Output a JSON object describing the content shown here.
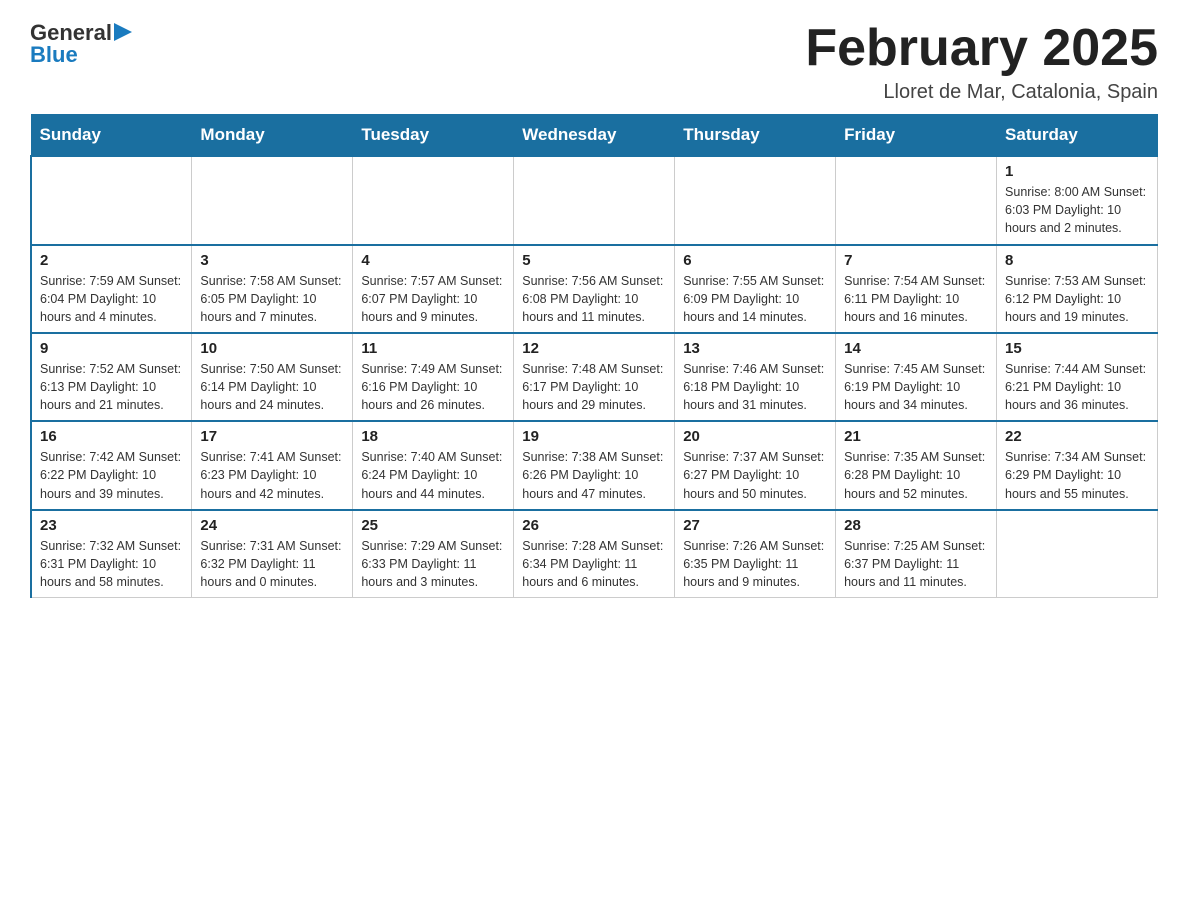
{
  "logo": {
    "general": "General",
    "blue": "Blue"
  },
  "title": "February 2025",
  "location": "Lloret de Mar, Catalonia, Spain",
  "weekdays": [
    "Sunday",
    "Monday",
    "Tuesday",
    "Wednesday",
    "Thursday",
    "Friday",
    "Saturday"
  ],
  "weeks": [
    [
      {
        "day": "",
        "info": ""
      },
      {
        "day": "",
        "info": ""
      },
      {
        "day": "",
        "info": ""
      },
      {
        "day": "",
        "info": ""
      },
      {
        "day": "",
        "info": ""
      },
      {
        "day": "",
        "info": ""
      },
      {
        "day": "1",
        "info": "Sunrise: 8:00 AM\nSunset: 6:03 PM\nDaylight: 10 hours and 2 minutes."
      }
    ],
    [
      {
        "day": "2",
        "info": "Sunrise: 7:59 AM\nSunset: 6:04 PM\nDaylight: 10 hours and 4 minutes."
      },
      {
        "day": "3",
        "info": "Sunrise: 7:58 AM\nSunset: 6:05 PM\nDaylight: 10 hours and 7 minutes."
      },
      {
        "day": "4",
        "info": "Sunrise: 7:57 AM\nSunset: 6:07 PM\nDaylight: 10 hours and 9 minutes."
      },
      {
        "day": "5",
        "info": "Sunrise: 7:56 AM\nSunset: 6:08 PM\nDaylight: 10 hours and 11 minutes."
      },
      {
        "day": "6",
        "info": "Sunrise: 7:55 AM\nSunset: 6:09 PM\nDaylight: 10 hours and 14 minutes."
      },
      {
        "day": "7",
        "info": "Sunrise: 7:54 AM\nSunset: 6:11 PM\nDaylight: 10 hours and 16 minutes."
      },
      {
        "day": "8",
        "info": "Sunrise: 7:53 AM\nSunset: 6:12 PM\nDaylight: 10 hours and 19 minutes."
      }
    ],
    [
      {
        "day": "9",
        "info": "Sunrise: 7:52 AM\nSunset: 6:13 PM\nDaylight: 10 hours and 21 minutes."
      },
      {
        "day": "10",
        "info": "Sunrise: 7:50 AM\nSunset: 6:14 PM\nDaylight: 10 hours and 24 minutes."
      },
      {
        "day": "11",
        "info": "Sunrise: 7:49 AM\nSunset: 6:16 PM\nDaylight: 10 hours and 26 minutes."
      },
      {
        "day": "12",
        "info": "Sunrise: 7:48 AM\nSunset: 6:17 PM\nDaylight: 10 hours and 29 minutes."
      },
      {
        "day": "13",
        "info": "Sunrise: 7:46 AM\nSunset: 6:18 PM\nDaylight: 10 hours and 31 minutes."
      },
      {
        "day": "14",
        "info": "Sunrise: 7:45 AM\nSunset: 6:19 PM\nDaylight: 10 hours and 34 minutes."
      },
      {
        "day": "15",
        "info": "Sunrise: 7:44 AM\nSunset: 6:21 PM\nDaylight: 10 hours and 36 minutes."
      }
    ],
    [
      {
        "day": "16",
        "info": "Sunrise: 7:42 AM\nSunset: 6:22 PM\nDaylight: 10 hours and 39 minutes."
      },
      {
        "day": "17",
        "info": "Sunrise: 7:41 AM\nSunset: 6:23 PM\nDaylight: 10 hours and 42 minutes."
      },
      {
        "day": "18",
        "info": "Sunrise: 7:40 AM\nSunset: 6:24 PM\nDaylight: 10 hours and 44 minutes."
      },
      {
        "day": "19",
        "info": "Sunrise: 7:38 AM\nSunset: 6:26 PM\nDaylight: 10 hours and 47 minutes."
      },
      {
        "day": "20",
        "info": "Sunrise: 7:37 AM\nSunset: 6:27 PM\nDaylight: 10 hours and 50 minutes."
      },
      {
        "day": "21",
        "info": "Sunrise: 7:35 AM\nSunset: 6:28 PM\nDaylight: 10 hours and 52 minutes."
      },
      {
        "day": "22",
        "info": "Sunrise: 7:34 AM\nSunset: 6:29 PM\nDaylight: 10 hours and 55 minutes."
      }
    ],
    [
      {
        "day": "23",
        "info": "Sunrise: 7:32 AM\nSunset: 6:31 PM\nDaylight: 10 hours and 58 minutes."
      },
      {
        "day": "24",
        "info": "Sunrise: 7:31 AM\nSunset: 6:32 PM\nDaylight: 11 hours and 0 minutes."
      },
      {
        "day": "25",
        "info": "Sunrise: 7:29 AM\nSunset: 6:33 PM\nDaylight: 11 hours and 3 minutes."
      },
      {
        "day": "26",
        "info": "Sunrise: 7:28 AM\nSunset: 6:34 PM\nDaylight: 11 hours and 6 minutes."
      },
      {
        "day": "27",
        "info": "Sunrise: 7:26 AM\nSunset: 6:35 PM\nDaylight: 11 hours and 9 minutes."
      },
      {
        "day": "28",
        "info": "Sunrise: 7:25 AM\nSunset: 6:37 PM\nDaylight: 11 hours and 11 minutes."
      },
      {
        "day": "",
        "info": ""
      }
    ]
  ]
}
